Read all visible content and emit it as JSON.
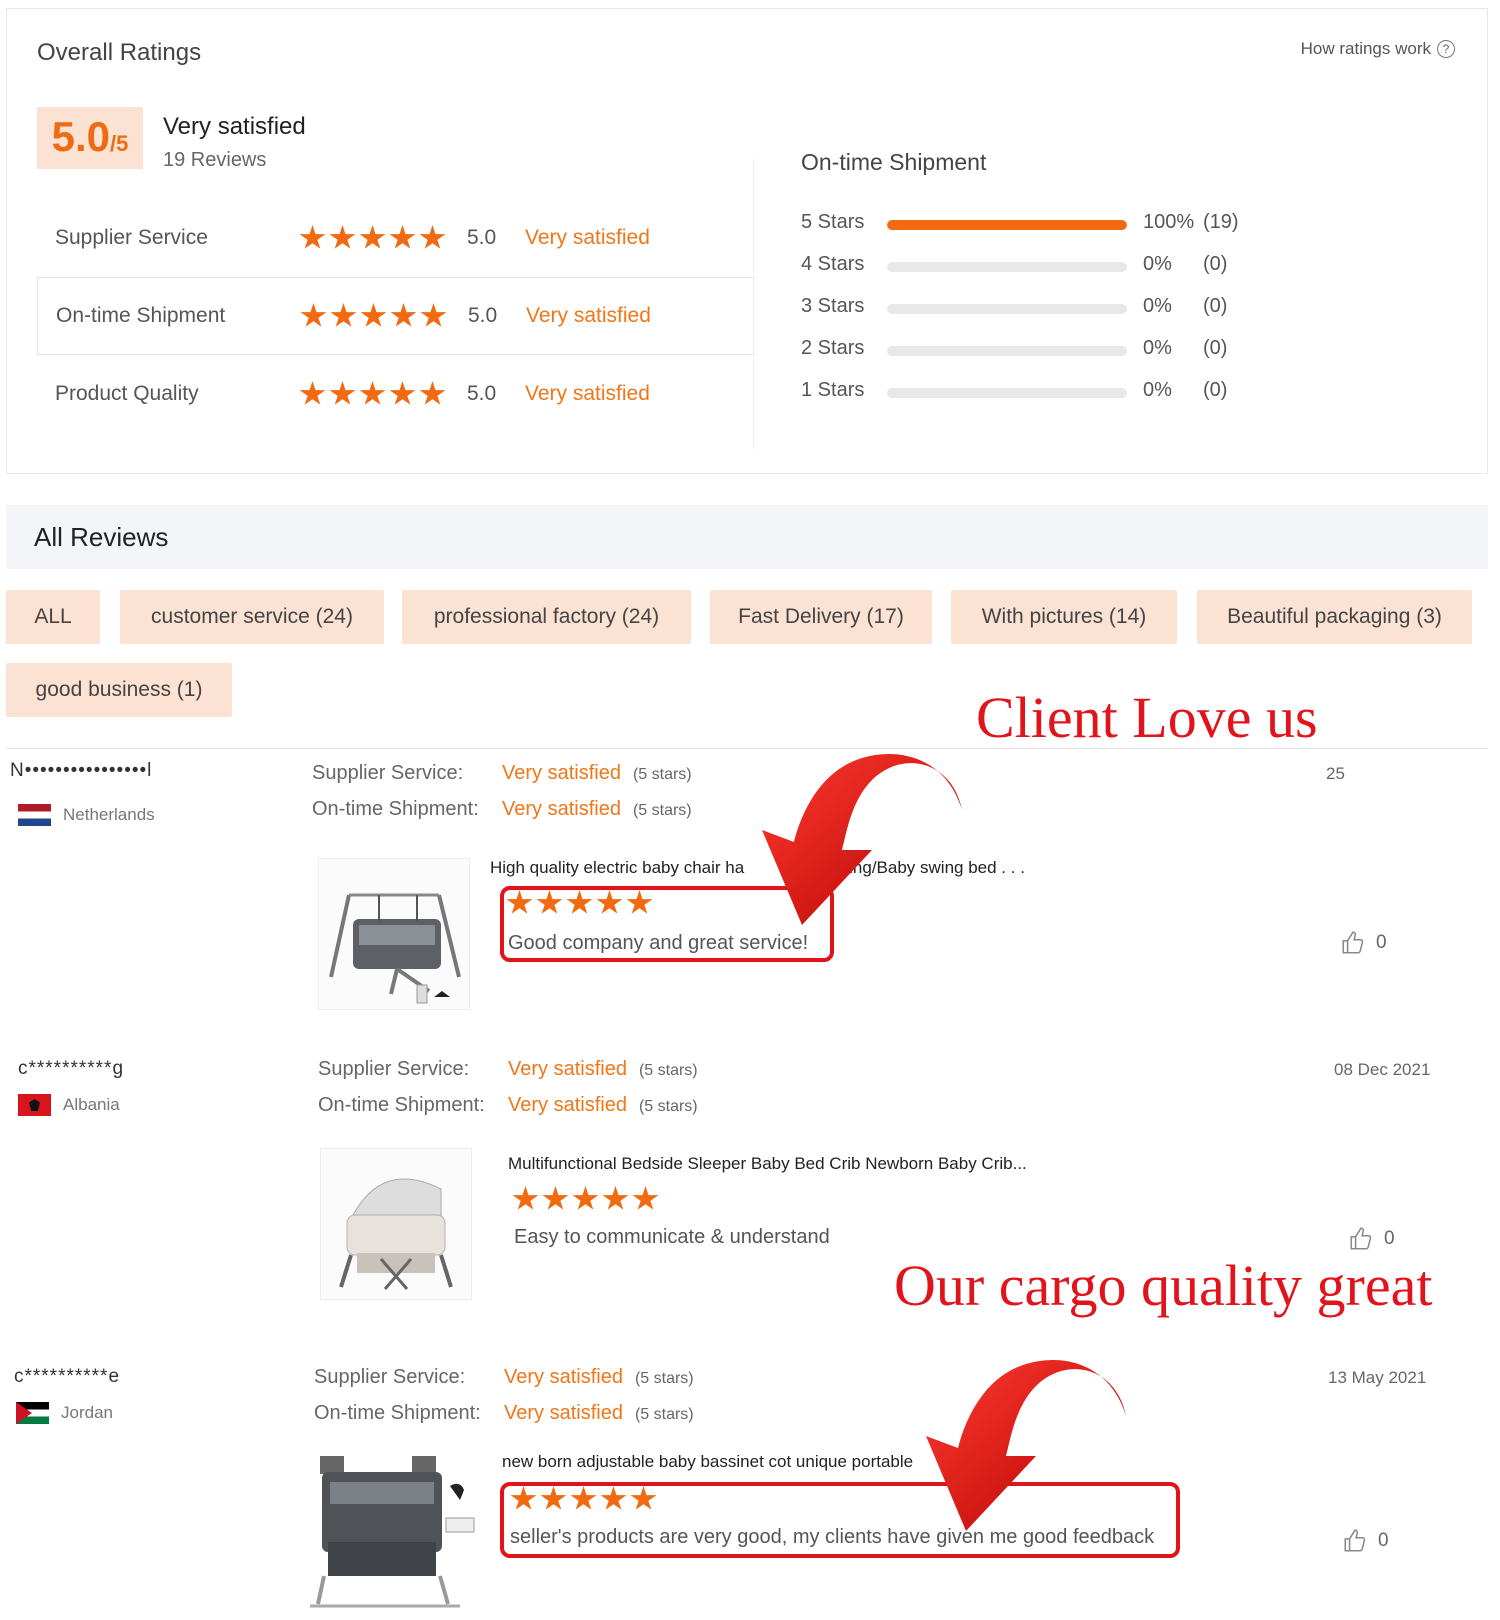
{
  "overall": {
    "title": "Overall Ratings",
    "how_ratings_work": "How ratings work",
    "score": "5.0",
    "score_suffix": "/5",
    "verdict": "Very satisfied",
    "reviews_count": "19 Reviews",
    "categories": [
      {
        "label": "Supplier Service",
        "score": "5.0",
        "verdict": "Very satisfied",
        "stars": 5
      },
      {
        "label": "On-time Shipment",
        "score": "5.0",
        "verdict": "Very satisfied",
        "stars": 5
      },
      {
        "label": "Product Quality",
        "score": "5.0",
        "verdict": "Very satisfied",
        "stars": 5
      }
    ]
  },
  "distribution": {
    "title": "On-time Shipment",
    "rows": [
      {
        "label": "5  Stars",
        "percent": "100%",
        "count": "(19)",
        "fill": 1.0
      },
      {
        "label": "4  Stars",
        "percent": "0%",
        "count": "(0)",
        "fill": 0
      },
      {
        "label": "3  Stars",
        "percent": "0%",
        "count": "(0)",
        "fill": 0
      },
      {
        "label": "2  Stars",
        "percent": "0%",
        "count": "(0)",
        "fill": 0
      },
      {
        "label": "1  Stars",
        "percent": "0%",
        "count": "(0)",
        "fill": 0
      }
    ]
  },
  "all_reviews": {
    "title": "All Reviews",
    "filters": [
      "ALL",
      "customer service (24)",
      "professional factory (24)",
      "Fast Delivery (17)",
      "With pictures (14)",
      "Beautiful packaging (3)",
      "good business (1)"
    ]
  },
  "promo": {
    "text1": "Client Love us",
    "text2": "Our cargo quality great"
  },
  "reviews": [
    {
      "name": "N••••••••••••••••l",
      "country": "Netherlands",
      "supplier_label": "Supplier Service:",
      "supplier_verdict": "Very satisfied",
      "supplier_stars": "(5 stars)",
      "shipment_label": "On-time Shipment:",
      "shipment_verdict": "Very satisfied",
      "shipment_stars": "(5 stars)",
      "date": "25",
      "product_title": "High quality electric baby chair ha",
      "product_title_tail": "e swing/Baby swing bed . . .",
      "rating": 5,
      "text": "Good company and great service!",
      "likes": "0"
    },
    {
      "name": "c**********g",
      "country": "Albania",
      "supplier_label": "Supplier Service:",
      "supplier_verdict": "Very satisfied",
      "supplier_stars": "(5 stars)",
      "shipment_label": "On-time Shipment:",
      "shipment_verdict": "Very satisfied",
      "shipment_stars": "(5 stars)",
      "date": "08 Dec 2021",
      "product_title": "Multifunctional Bedside Sleeper Baby Bed Crib Newborn  Baby Crib...",
      "rating": 5,
      "text": "Easy to communicate & understand",
      "likes": "0"
    },
    {
      "name": "c**********e",
      "country": "Jordan",
      "supplier_label": "Supplier Service:",
      "supplier_verdict": "Very satisfied",
      "supplier_stars": "(5 stars)",
      "shipment_label": "On-time Shipment:",
      "shipment_verdict": "Very satisfied",
      "shipment_stars": "(5 stars)",
      "date": "13 May 2021",
      "product_title": "new born adjustable baby bassinet cot unique portable",
      "rating": 5,
      "text": "seller's products are very good, my clients have given me good feedback",
      "likes": "0"
    }
  ]
}
